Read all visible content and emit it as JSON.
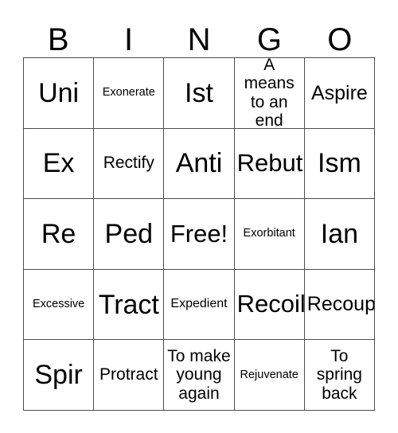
{
  "card": {
    "title": "BINGO",
    "header_letters": [
      "B",
      "I",
      "N",
      "G",
      "O"
    ],
    "grid_size": "5x5",
    "colors": {
      "background": "#ffffff",
      "text": "#000000",
      "grid_line": "#4d4d4d"
    },
    "rows": [
      [
        {
          "text": "Uni",
          "size": "xl",
          "lines": 1
        },
        {
          "text": "Exonerate",
          "size": "xxs",
          "lines": 1
        },
        {
          "text": "Ist",
          "size": "xl",
          "lines": 1
        },
        {
          "text": "A means\nto an end",
          "size": "sm",
          "lines": 2
        },
        {
          "text": "Aspire",
          "size": "md",
          "lines": 1
        }
      ],
      [
        {
          "text": "Ex",
          "size": "xl",
          "lines": 1
        },
        {
          "text": "Rectify",
          "size": "sm",
          "lines": 1
        },
        {
          "text": "Anti",
          "size": "xl",
          "lines": 1
        },
        {
          "text": "Rebut",
          "size": "lg",
          "lines": 1
        },
        {
          "text": "Ism",
          "size": "xl",
          "lines": 1
        }
      ],
      [
        {
          "text": "Re",
          "size": "xl",
          "lines": 1
        },
        {
          "text": "Ped",
          "size": "xl",
          "lines": 1
        },
        {
          "text": "Free!",
          "size": "lg",
          "lines": 1
        },
        {
          "text": "Exorbitant",
          "size": "xxs",
          "lines": 1
        },
        {
          "text": "Ian",
          "size": "xl",
          "lines": 1
        }
      ],
      [
        {
          "text": "Excessive",
          "size": "xxs",
          "lines": 1
        },
        {
          "text": "Tract",
          "size": "xl",
          "lines": 1
        },
        {
          "text": "Expedient",
          "size": "xs",
          "lines": 1
        },
        {
          "text": "Recoil",
          "size": "lg",
          "lines": 1
        },
        {
          "text": "Recoup",
          "size": "md",
          "lines": 1
        }
      ],
      [
        {
          "text": "Spir",
          "size": "xl",
          "lines": 1
        },
        {
          "text": "Protract",
          "size": "sm",
          "lines": 1
        },
        {
          "text": "To make\nyoung\nagain",
          "size": "sm",
          "lines": 3
        },
        {
          "text": "Rejuvenate",
          "size": "xxs",
          "lines": 1
        },
        {
          "text": "To\nspring\nback",
          "size": "sm",
          "lines": 3
        }
      ]
    ]
  }
}
